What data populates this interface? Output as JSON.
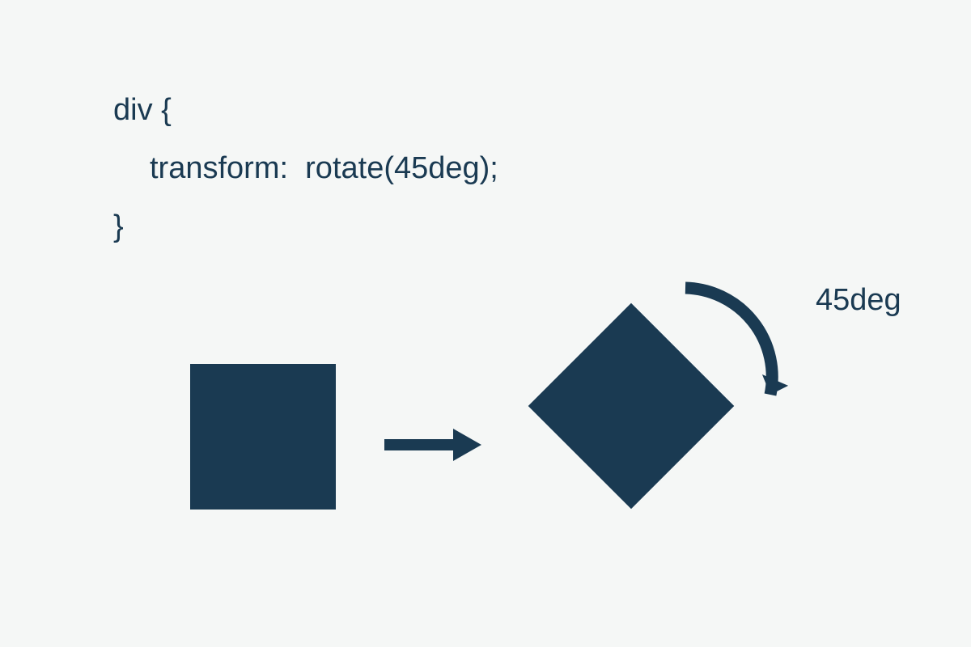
{
  "code": {
    "line1": "div {",
    "line2": "transform:  rotate(45deg);",
    "line3": "}"
  },
  "diagram": {
    "angle_label": "45deg",
    "rotation_degrees": 45,
    "shape_color": "#1a3a52"
  }
}
